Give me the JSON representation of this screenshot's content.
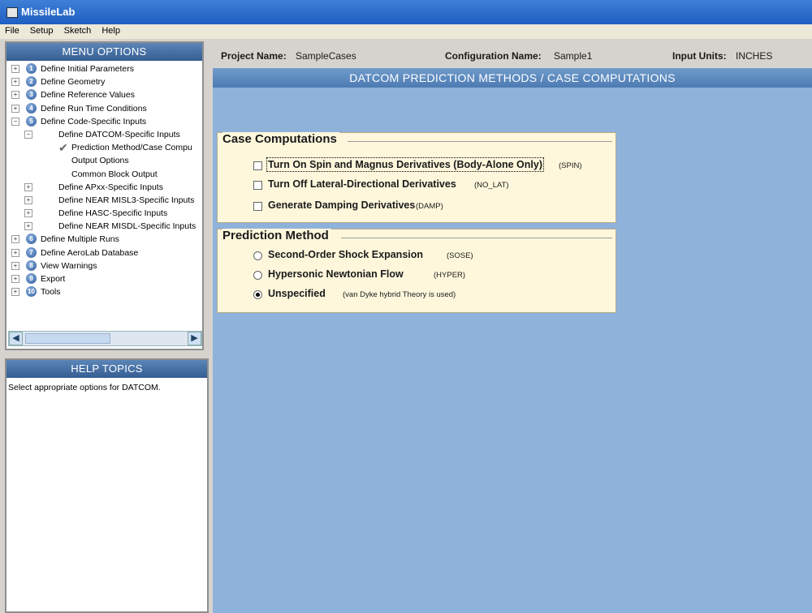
{
  "app": {
    "title": "MissileLab"
  },
  "menubar": [
    "File",
    "Setup",
    "Sketch",
    "Help"
  ],
  "menu_panel": {
    "header": "MENU OPTIONS",
    "tree": [
      {
        "label": "Define Initial Parameters",
        "num": "1",
        "expander": "+",
        "level": 0
      },
      {
        "label": "Define Geometry",
        "num": "2",
        "expander": "+",
        "level": 0
      },
      {
        "label": "Define Reference Values",
        "num": "3",
        "expander": "+",
        "level": 0
      },
      {
        "label": "Define Run Time Conditions",
        "num": "4",
        "expander": "+",
        "level": 0
      },
      {
        "label": "Define Code-Specific Inputs",
        "num": "5",
        "expander": "−",
        "level": 0
      },
      {
        "label": "Define DATCOM-Specific Inputs",
        "expander": "−",
        "level": 1
      },
      {
        "label": "Prediction Method/Case Compu",
        "level": 2,
        "checked": true
      },
      {
        "label": "Output Options",
        "level": 2
      },
      {
        "label": "Common Block Output",
        "level": 2
      },
      {
        "label": "Define APxx-Specific Inputs",
        "expander": "+",
        "level": 1
      },
      {
        "label": "Define NEAR MISL3-Specific Inputs",
        "expander": "+",
        "level": 1
      },
      {
        "label": "Define HASC-Specific Inputs",
        "expander": "+",
        "level": 1
      },
      {
        "label": "Define NEAR MISDL-Specific Inputs",
        "expander": "+",
        "level": 1
      },
      {
        "label": "Define Multiple Runs",
        "num": "6",
        "expander": "+",
        "level": 0
      },
      {
        "label": "Define AeroLab Database",
        "num": "7",
        "expander": "+",
        "level": 0
      },
      {
        "label": "View Warnings",
        "num": "8",
        "expander": "+",
        "level": 0
      },
      {
        "label": "Export",
        "num": "9",
        "expander": "+",
        "level": 0
      },
      {
        "label": "Tools",
        "num": "10",
        "expander": "+",
        "level": 0
      }
    ]
  },
  "help_panel": {
    "header": "HELP TOPICS",
    "text": "Select appropriate options for DATCOM."
  },
  "project": {
    "name_label": "Project Name:",
    "name_value": "SampleCases",
    "config_label": "Configuration Name:",
    "config_value": "Sample1",
    "units_label": "Input Units:",
    "units_value": "INCHES"
  },
  "main": {
    "header": "DATCOM PREDICTION METHODS / CASE COMPUTATIONS",
    "case_computations": {
      "title": "Case Computations",
      "options": [
        {
          "label": "Turn On Spin and Magnus Derivatives (Body-Alone Only)",
          "code": "(SPIN)",
          "checked": false
        },
        {
          "label": "Turn Off Lateral-Directional Derivatives",
          "code": "(NO_LAT)",
          "checked": false
        },
        {
          "label": "Generate Damping Derivatives",
          "code": "(DAMP)",
          "checked": false
        }
      ]
    },
    "prediction_method": {
      "title": "Prediction Method",
      "options": [
        {
          "label": "Second-Order Shock Expansion",
          "code": "(SOSE)",
          "selected": false
        },
        {
          "label": "Hypersonic Newtonian Flow",
          "code": "(HYPER)",
          "selected": false
        },
        {
          "label": "Unspecified",
          "code": "(van Dyke hybrid Theory is used)",
          "selected": true
        }
      ]
    }
  }
}
